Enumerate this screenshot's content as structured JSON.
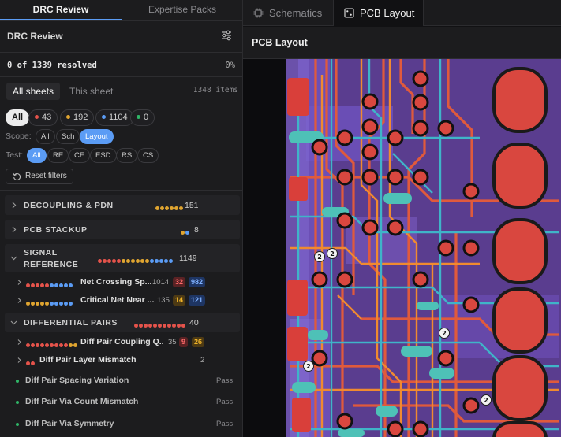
{
  "left_tabs": [
    "DRC Review",
    "Expertise Packs"
  ],
  "panel": {
    "title": "DRC Review",
    "settings_icon": "sliders-icon"
  },
  "progress": {
    "text": "0 of 1339 resolved",
    "percent": "0%"
  },
  "sheet_tabs": [
    "All sheets",
    "This sheet"
  ],
  "items_count": "1348 items",
  "severity_chips": [
    {
      "label": "All",
      "color": null
    },
    {
      "label": "43",
      "color": "#e5534b"
    },
    {
      "label": "192",
      "color": "#e0a530"
    },
    {
      "label": "1104",
      "color": "#5b9cf5"
    },
    {
      "label": "0",
      "color": "#2fb567"
    }
  ],
  "scope": {
    "label": "Scope:",
    "options": [
      "All",
      "Sch",
      "Layout"
    ],
    "selected": "Layout"
  },
  "test": {
    "label": "Test:",
    "options": [
      "All",
      "RE",
      "CE",
      "ESD",
      "RS",
      "CS"
    ],
    "selected": "All"
  },
  "reset_label": "Reset filters",
  "groups": [
    {
      "name": "DECOUPLING & PDN",
      "count": "151"
    },
    {
      "name": "PCB STACKUP",
      "count": "8"
    },
    {
      "name_line1": "SIGNAL",
      "name_line2": "REFERENCE",
      "count": "1149"
    },
    {
      "name": "DIFFERENTIAL PAIRS",
      "count": "40"
    }
  ],
  "rows": [
    {
      "name": "Net Crossing Sp...",
      "count": "1014",
      "badges": [
        "32",
        "982"
      ]
    },
    {
      "name": "Critical Net Near ...",
      "count": "135",
      "badges": [
        "14",
        "121"
      ]
    },
    {
      "name": "Diff Pair Coupling Q...",
      "count": "35",
      "badges": [
        "9",
        "26"
      ]
    },
    {
      "name": "Diff Pair Layer Mismatch",
      "count": "2",
      "badges": []
    }
  ],
  "pass_rows": [
    {
      "name": "Diff Pair Spacing Variation",
      "status": "Pass"
    },
    {
      "name": "Diff Pair Via Count Mismatch",
      "status": "Pass"
    },
    {
      "name": "Diff Pair Via Symmetry",
      "status": "Pass"
    }
  ],
  "right_tabs": [
    "Schematics",
    "PCB Layout"
  ],
  "right_title": "PCB Layout",
  "markers": [
    "2",
    "2",
    "2",
    "2",
    "2"
  ],
  "colors": {
    "accent": "#5b9cf5",
    "error": "#e5534b",
    "warning": "#e0a530",
    "info": "#5b9cf5",
    "pass": "#2fb567"
  }
}
